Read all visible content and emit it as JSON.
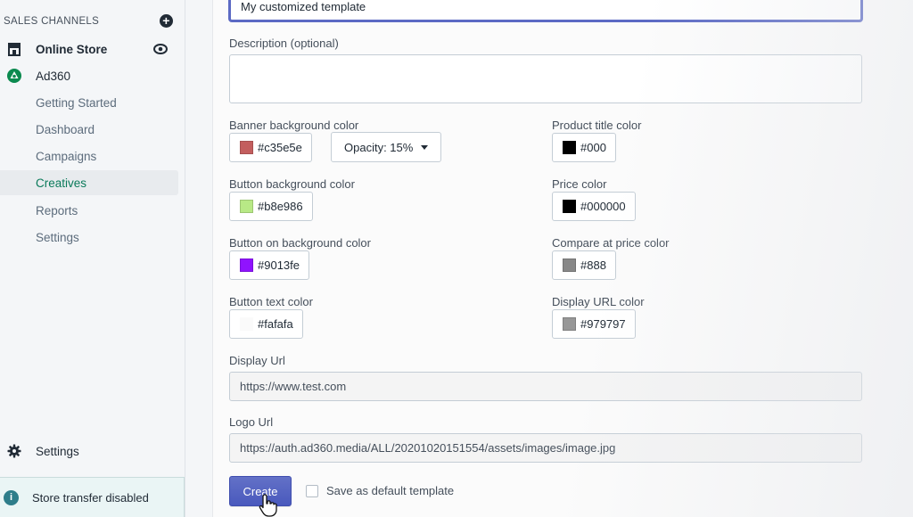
{
  "sidebar": {
    "section_title": "SALES CHANNELS",
    "add_icon": "plus-circle-icon",
    "online_store": {
      "label": "Online Store",
      "icon": "store-icon",
      "view_icon": "eye-icon"
    },
    "app": {
      "label": "Ad360",
      "icon": "ad360-logo"
    },
    "sub_items": [
      {
        "label": "Getting Started",
        "active": false
      },
      {
        "label": "Dashboard",
        "active": false
      },
      {
        "label": "Campaigns",
        "active": false
      },
      {
        "label": "Creatives",
        "active": true
      },
      {
        "label": "Reports",
        "active": false
      },
      {
        "label": "Settings",
        "active": false
      }
    ],
    "settings": {
      "label": "Settings",
      "icon": "gear-icon"
    },
    "notice": {
      "label": "Store transfer disabled",
      "icon": "info-icon"
    }
  },
  "form": {
    "name_value": "My customized template",
    "description": {
      "label": "Description (optional)",
      "value": ""
    },
    "banner_bg": {
      "label": "Banner background color",
      "value": "#c35e5e",
      "color": "#c35e5e"
    },
    "opacity": {
      "label": "Opacity: 15%"
    },
    "product_title": {
      "label": "Product title color",
      "value": "#000",
      "color": "#000000"
    },
    "button_bg": {
      "label": "Button background color",
      "value": "#b8e986",
      "color": "#b8e986"
    },
    "price": {
      "label": "Price color",
      "value": "#000000",
      "color": "#000000"
    },
    "button_on_bg": {
      "label": "Button on background color",
      "value": "#9013fe",
      "color": "#9013fe"
    },
    "compare_price": {
      "label": "Compare at price color",
      "value": "#888",
      "color": "#888888"
    },
    "button_text": {
      "label": "Button text color",
      "value": "#fafafa",
      "color": "#fafafa"
    },
    "display_url_color": {
      "label": "Display URL color",
      "value": "#979797",
      "color": "#979797"
    },
    "display_url": {
      "label": "Display Url",
      "value": "https://www.test.com"
    },
    "logo_url": {
      "label": "Logo Url",
      "value": "https://auth.ad360.media/ALL/20201020151554/assets/images/image.jpg"
    },
    "create_label": "Create",
    "default_label": "Save as default template"
  }
}
